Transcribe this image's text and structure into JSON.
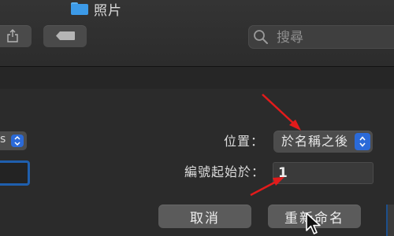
{
  "toolbar": {
    "folder_name": "照片",
    "search_placeholder": "搜尋"
  },
  "rename_sheet": {
    "left_select_value": "s",
    "position_label": "位置：",
    "position_value": "於名稱之後",
    "start_number_label": "編號起始於：",
    "start_number_value": "1",
    "cancel_label": "取消",
    "rename_label": "重新命名"
  },
  "colors": {
    "accent_blue": "#2b6ad8",
    "annotation_red": "#e21b1b"
  },
  "icons": [
    "folder-icon",
    "share-icon",
    "tag-icon",
    "search-icon",
    "stepper-icon",
    "annotation-arrow",
    "mouse-cursor-icon"
  ]
}
